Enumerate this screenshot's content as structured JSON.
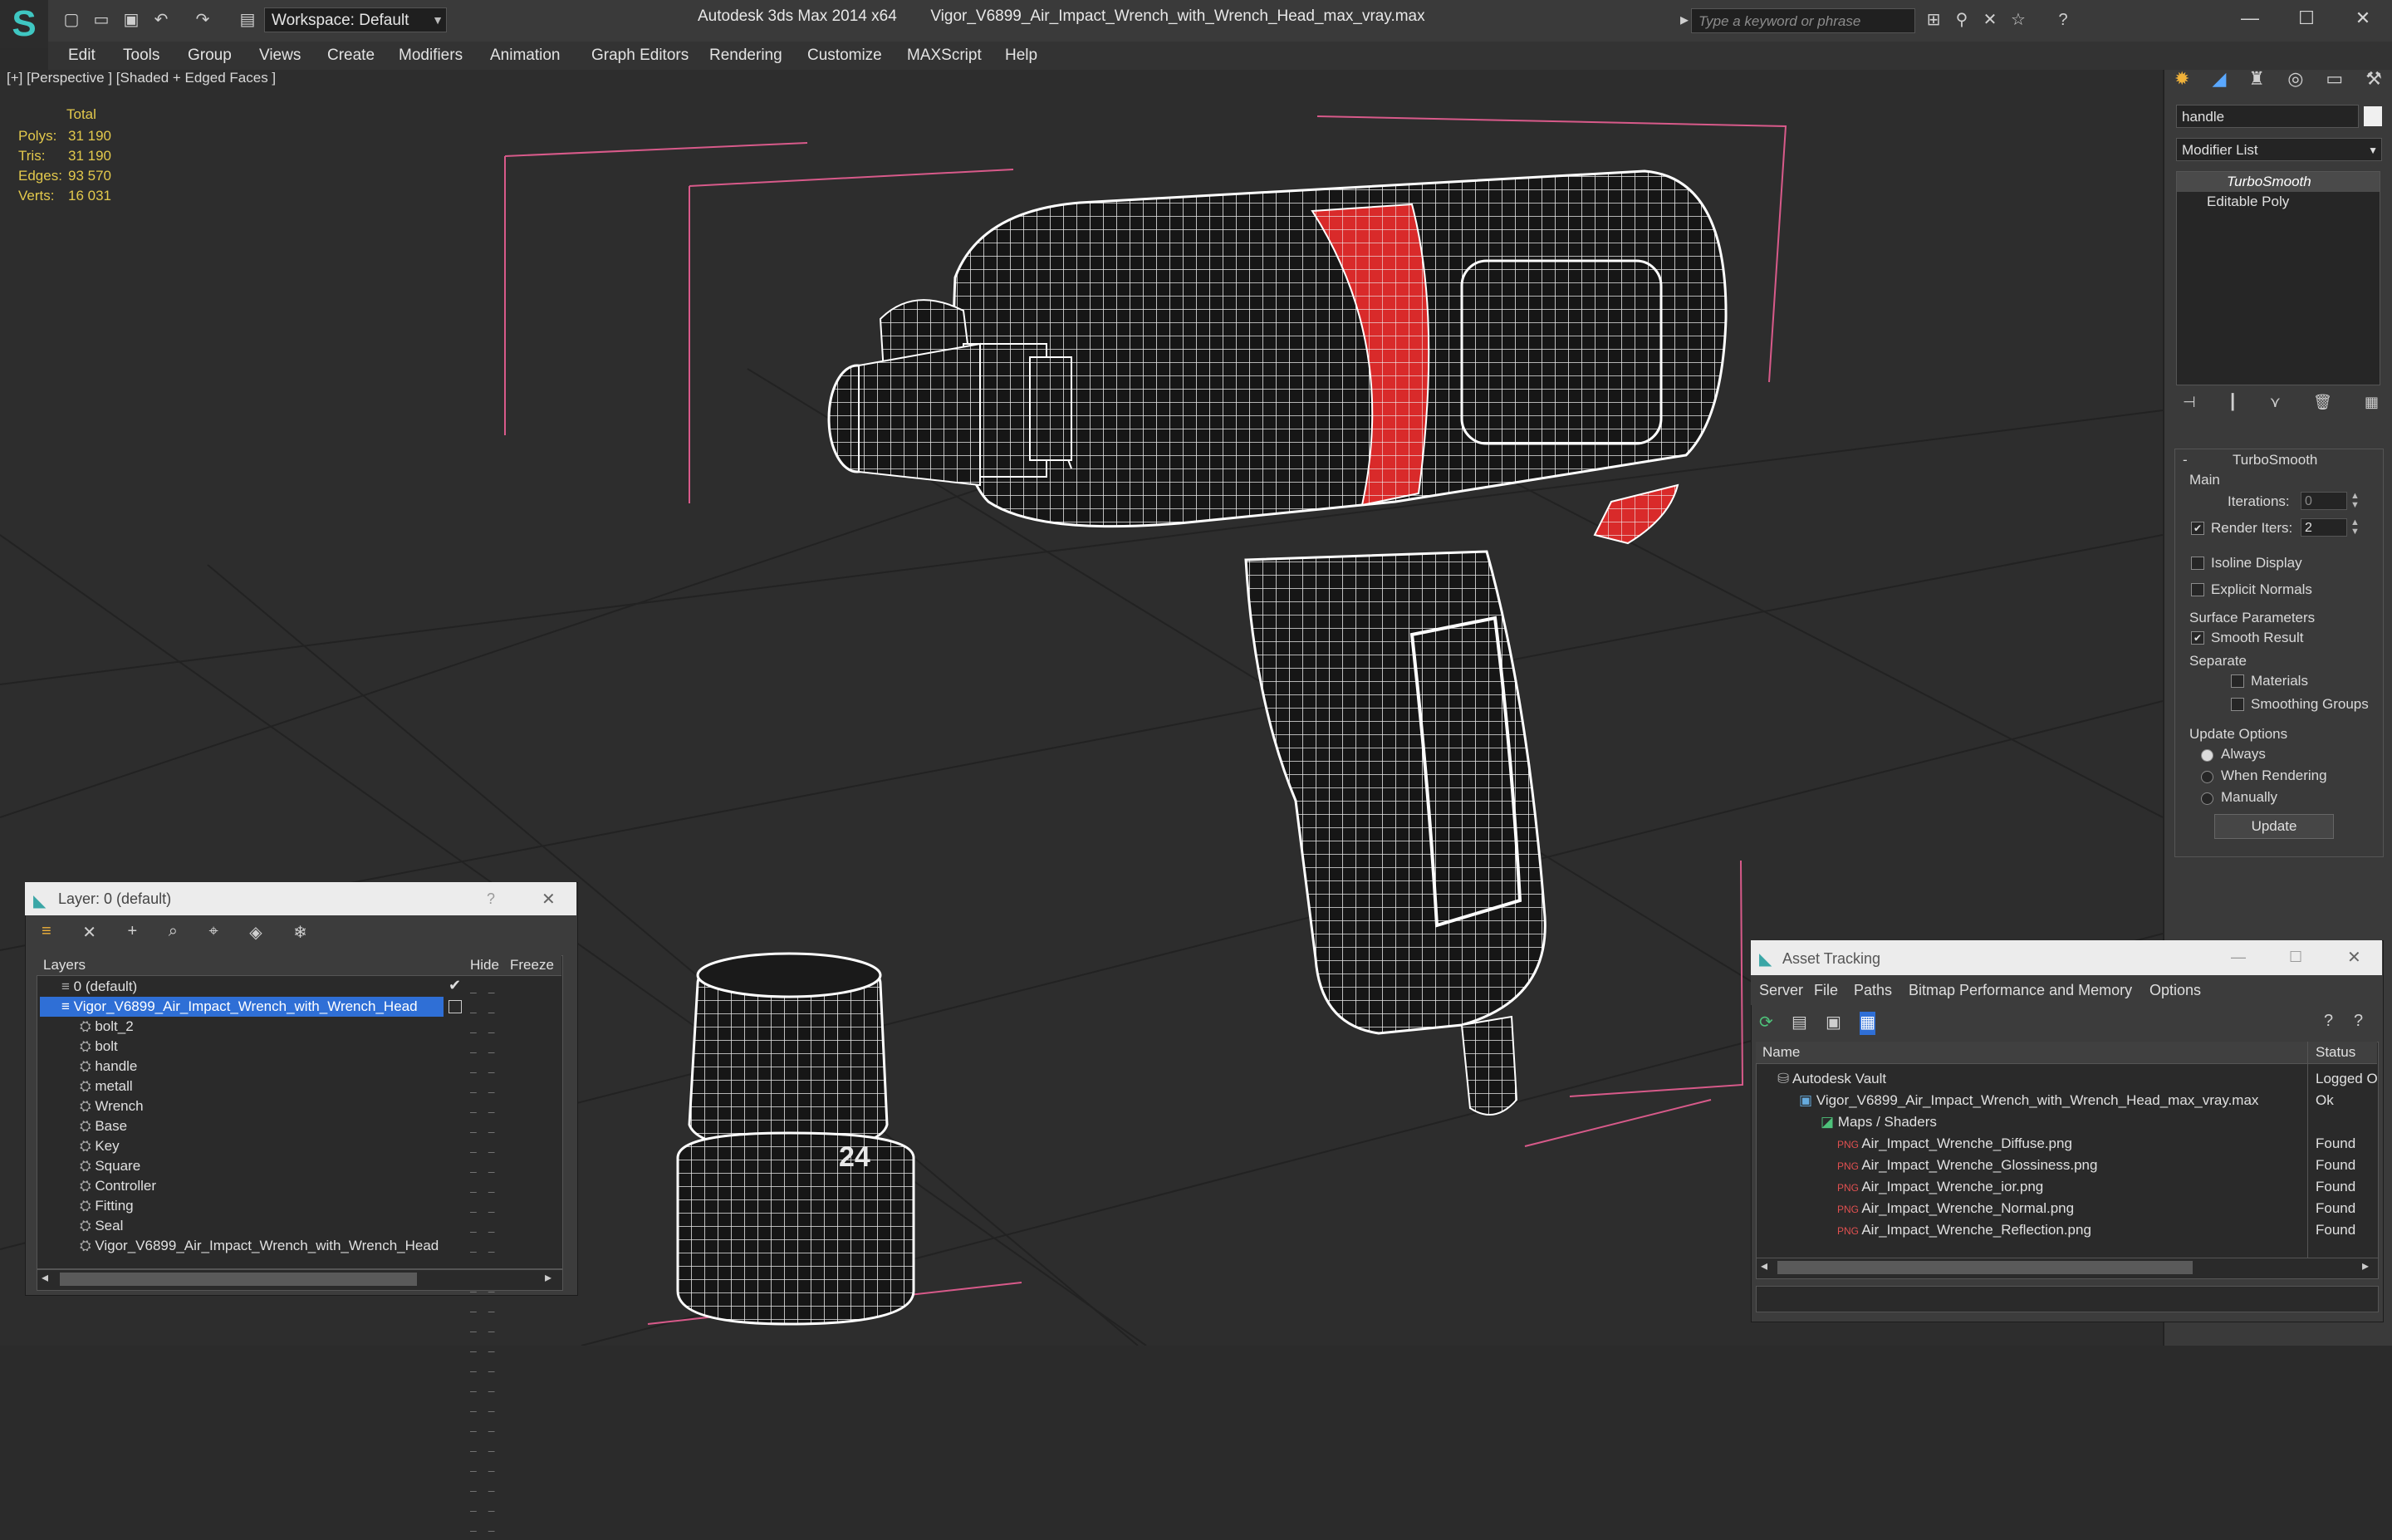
{
  "titlebar": {
    "workspace": "Workspace: Default",
    "app_title": "Autodesk 3ds Max  2014 x64",
    "file_title": "Vigor_V6899_Air_Impact_Wrench_with_Wrench_Head_max_vray.max",
    "search_placeholder": "Type a keyword or phrase"
  },
  "menu": [
    "Edit",
    "Tools",
    "Group",
    "Views",
    "Create",
    "Modifiers",
    "Animation",
    "Graph Editors",
    "Rendering",
    "Customize",
    "MAXScript",
    "Help"
  ],
  "viewport": {
    "label": "[+] [Perspective ] [Shaded + Edged Faces ]",
    "stats": {
      "header": "Total",
      "rows": [
        {
          "label": "Polys:",
          "value": "31 190"
        },
        {
          "label": "Tris:",
          "value": "31 190"
        },
        {
          "label": "Edges:",
          "value": "93 570"
        },
        {
          "label": "Verts:",
          "value": "16 031"
        }
      ]
    },
    "socket_marking": "24"
  },
  "command_panel": {
    "object_name": "handle",
    "modifier_list": "Modifier List",
    "stack": [
      "TurboSmooth",
      "Editable Poly"
    ],
    "rollout_title": "TurboSmooth",
    "main_label": "Main",
    "iterations_label": "Iterations:",
    "iterations_value": "0",
    "render_iters_label": "Render Iters:",
    "render_iters_value": "2",
    "render_iters_checked": true,
    "isoline_label": "Isoline Display",
    "explicit_normals_label": "Explicit Normals",
    "surface_params_label": "Surface Parameters",
    "smooth_result_label": "Smooth Result",
    "smooth_result_checked": true,
    "separate_label": "Separate",
    "materials_label": "Materials",
    "smoothing_groups_label": "Smoothing Groups",
    "update_options_label": "Update Options",
    "update_options": [
      "Always",
      "When Rendering",
      "Manually"
    ],
    "update_selected": "Always",
    "update_button": "Update"
  },
  "layer_panel": {
    "title": "Layer: 0 (default)",
    "help": "?",
    "columns": [
      "Layers",
      "Hide",
      "Freeze"
    ],
    "layers": [
      {
        "name": "0 (default)",
        "kind": "layer",
        "selected": false
      },
      {
        "name": "Vigor_V6899_Air_Impact_Wrench_with_Wrench_Head",
        "kind": "layer",
        "selected": true
      },
      {
        "name": "bolt_2",
        "kind": "object",
        "selected": false
      },
      {
        "name": "bolt",
        "kind": "object",
        "selected": false
      },
      {
        "name": "handle",
        "kind": "object",
        "selected": false
      },
      {
        "name": "metall",
        "kind": "object",
        "selected": false
      },
      {
        "name": "Wrench",
        "kind": "object",
        "selected": false
      },
      {
        "name": "Base",
        "kind": "object",
        "selected": false
      },
      {
        "name": "Key",
        "kind": "object",
        "selected": false
      },
      {
        "name": "Square",
        "kind": "object",
        "selected": false
      },
      {
        "name": "Controller",
        "kind": "object",
        "selected": false
      },
      {
        "name": "Fitting",
        "kind": "object",
        "selected": false
      },
      {
        "name": "Seal",
        "kind": "object",
        "selected": false
      },
      {
        "name": "Vigor_V6899_Air_Impact_Wrench_with_Wrench_Head",
        "kind": "object",
        "selected": false
      }
    ]
  },
  "asset_panel": {
    "title": "Asset Tracking",
    "menu": [
      "Server",
      "File",
      "Paths",
      "Bitmap Performance and Memory",
      "Options"
    ],
    "columns": [
      "Name",
      "Status"
    ],
    "rows": [
      {
        "name": "Autodesk Vault",
        "status": "Logged O",
        "level": 0,
        "icon": "vault"
      },
      {
        "name": "Vigor_V6899_Air_Impact_Wrench_with_Wrench_Head_max_vray.max",
        "status": "Ok",
        "level": 1,
        "icon": "max"
      },
      {
        "name": "Maps / Shaders",
        "status": "",
        "level": 2,
        "icon": "maps"
      },
      {
        "name": "Air_Impact_Wrenche_Diffuse.png",
        "status": "Found",
        "level": 3,
        "icon": "png"
      },
      {
        "name": "Air_Impact_Wrenche_Glossiness.png",
        "status": "Found",
        "level": 3,
        "icon": "png"
      },
      {
        "name": "Air_Impact_Wrenche_ior.png",
        "status": "Found",
        "level": 3,
        "icon": "png"
      },
      {
        "name": "Air_Impact_Wrenche_Normal.png",
        "status": "Found",
        "level": 3,
        "icon": "png"
      },
      {
        "name": "Air_Impact_Wrenche_Reflection.png",
        "status": "Found",
        "level": 3,
        "icon": "png"
      }
    ]
  }
}
